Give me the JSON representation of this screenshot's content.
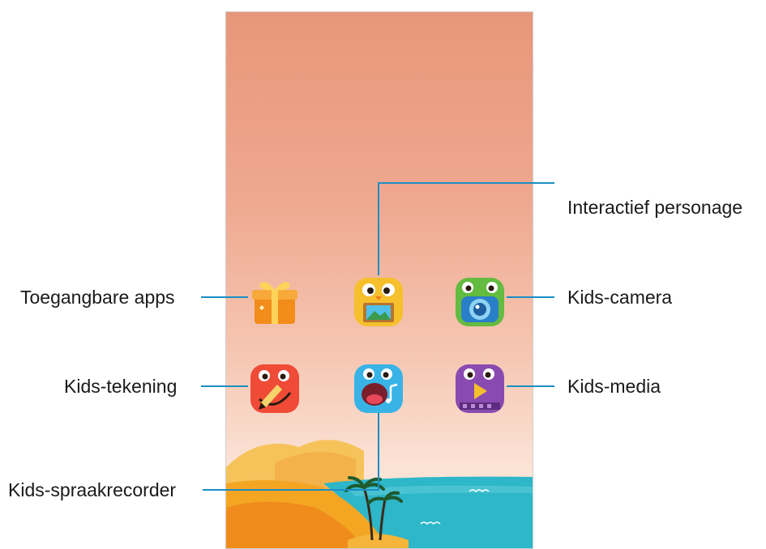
{
  "callouts": {
    "interactive_character": "Interactief personage",
    "accessible_apps": "Toegangbare apps",
    "kids_camera": "Kids-camera",
    "kids_drawing": "Kids-tekening",
    "kids_media": "Kids-media",
    "kids_voice_recorder": "Kids-spraakrecorder"
  },
  "icons": {
    "accessible_apps": "gift-icon",
    "interactive_character": "character-picture-icon",
    "kids_camera": "camera-monster-icon",
    "kids_drawing": "pencil-monster-icon",
    "kids_voice_recorder": "music-monster-icon",
    "kids_media": "play-monster-icon"
  },
  "colors": {
    "leader_line": "#1a8ec4",
    "sky_top": "#e8967a",
    "sky_bottom": "#fce8dc",
    "sea": "#2eb6c9",
    "sand": "#f4a623"
  }
}
